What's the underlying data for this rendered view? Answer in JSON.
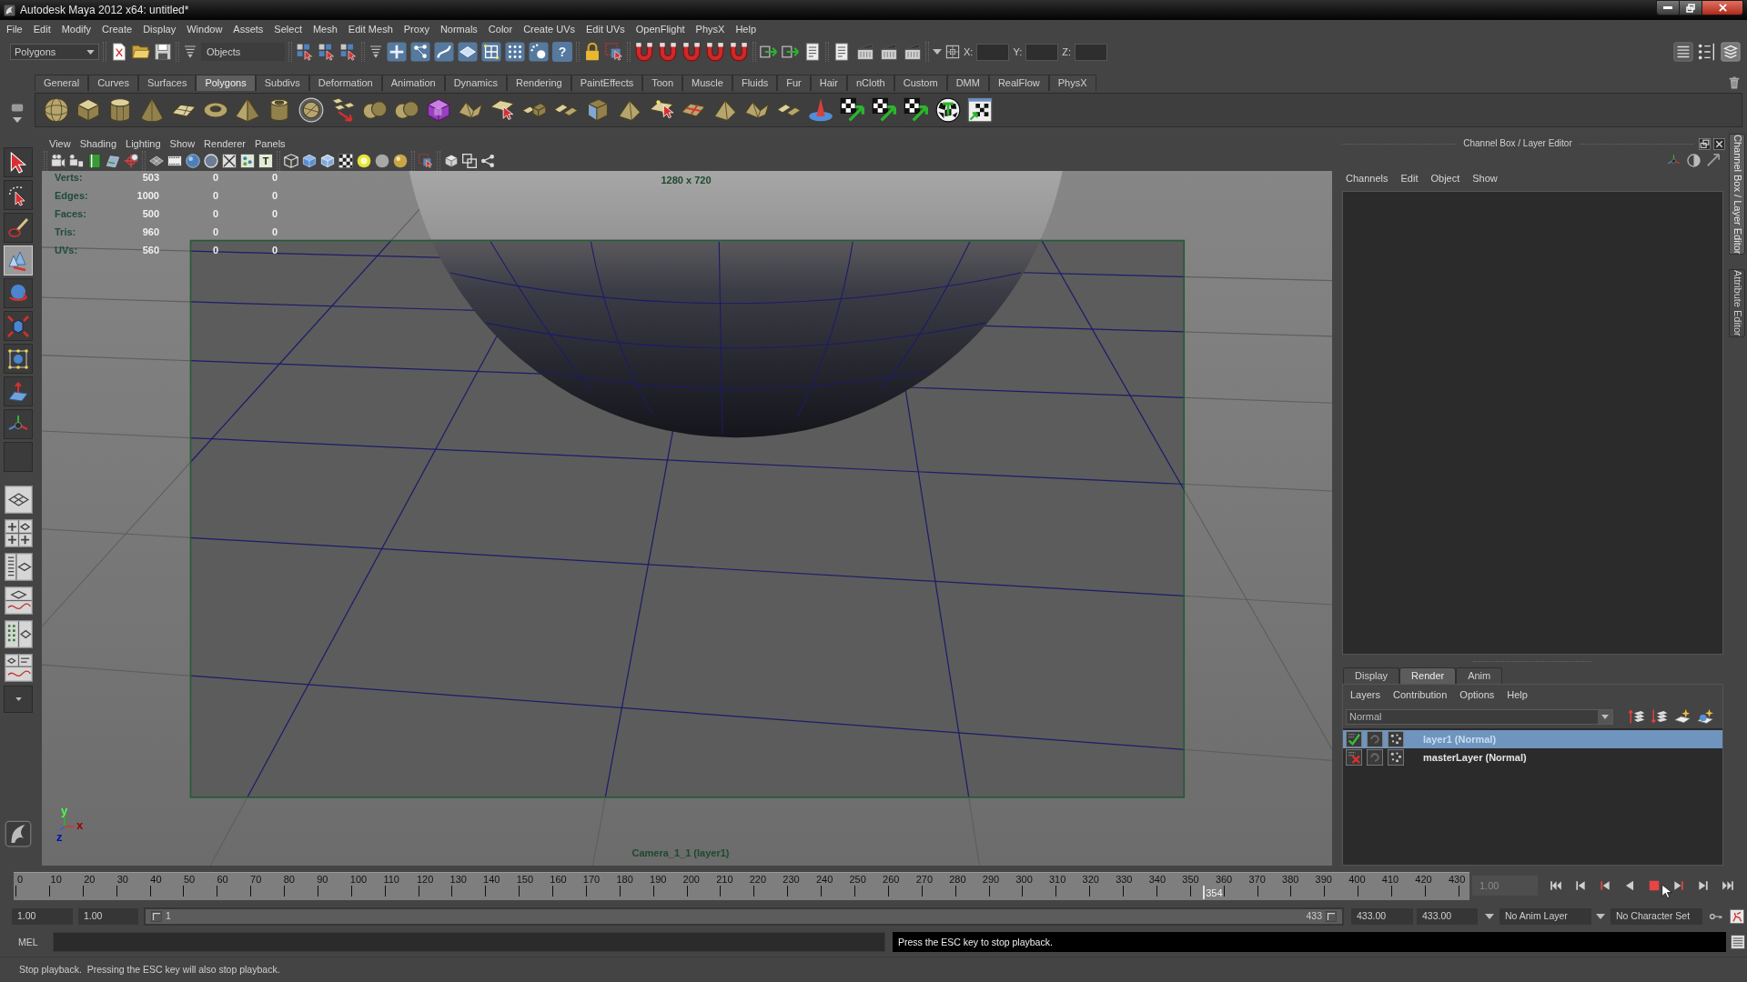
{
  "window": {
    "title": "Autodesk Maya 2012 x64: untitled*"
  },
  "menu_bar": [
    "File",
    "Edit",
    "Modify",
    "Create",
    "Display",
    "Window",
    "Assets",
    "Select",
    "Mesh",
    "Edit Mesh",
    "Proxy",
    "Normals",
    "Color",
    "Create UVs",
    "Edit UVs",
    "OpenFlight",
    "PhysX",
    "Help"
  ],
  "status_line": {
    "menu_set": "Polygons",
    "selection_mode": "Objects",
    "help_button": "?",
    "coordinate_fields": [
      {
        "label": "X:"
      },
      {
        "label": "Y:"
      },
      {
        "label": "Z:"
      }
    ]
  },
  "shelf": {
    "tabs": [
      {
        "label": "General",
        "selected": false
      },
      {
        "label": "Curves",
        "selected": false
      },
      {
        "label": "Surfaces",
        "selected": false
      },
      {
        "label": "Polygons",
        "selected": true
      },
      {
        "label": "Subdivs",
        "selected": false
      },
      {
        "label": "Deformation",
        "selected": false
      },
      {
        "label": "Animation",
        "selected": false
      },
      {
        "label": "Dynamics",
        "selected": false
      },
      {
        "label": "Rendering",
        "selected": false
      },
      {
        "label": "PaintEffects",
        "selected": false
      },
      {
        "label": "Toon",
        "selected": false
      },
      {
        "label": "Muscle",
        "selected": false
      },
      {
        "label": "Fluids",
        "selected": false
      },
      {
        "label": "Fur",
        "selected": false
      },
      {
        "label": "Hair",
        "selected": false
      },
      {
        "label": "nCloth",
        "selected": false
      },
      {
        "label": "Custom",
        "selected": false
      },
      {
        "label": "DMM",
        "selected": false
      },
      {
        "label": "RealFlow",
        "selected": false
      },
      {
        "label": "PhysX",
        "selected": false
      }
    ]
  },
  "toolbox": {
    "tools": [
      {
        "selected": false
      },
      {
        "selected": false
      },
      {
        "selected": false
      },
      {
        "selected": true
      },
      {
        "selected": false
      },
      {
        "selected": false
      },
      {
        "selected": false
      },
      {
        "selected": false
      },
      {
        "selected": false
      }
    ]
  },
  "viewport": {
    "menus": [
      "View",
      "Shading",
      "Lighting",
      "Show",
      "Renderer",
      "Panels"
    ],
    "text_button": "T",
    "hud": [
      {
        "label": "Verts:",
        "values": [
          "503",
          "0",
          "0"
        ]
      },
      {
        "label": "Edges:",
        "values": [
          "1000",
          "0",
          "0"
        ]
      },
      {
        "label": "Faces:",
        "values": [
          "500",
          "0",
          "0"
        ]
      },
      {
        "label": "Tris:",
        "values": [
          "960",
          "0",
          "0"
        ]
      },
      {
        "label": "UVs:",
        "values": [
          "560",
          "0",
          "0"
        ]
      }
    ],
    "resolution": "1280 x 720",
    "camera": "Camera_1_1 (layer1)",
    "axes": [
      "y",
      "x",
      "z"
    ]
  },
  "channel_box": {
    "title": "Channel Box / Layer Editor",
    "menus": [
      "Channels",
      "Edit",
      "Object",
      "Show"
    ]
  },
  "layer_editor": {
    "tabs": [
      {
        "label": "Display",
        "selected": false
      },
      {
        "label": "Render",
        "selected": true
      },
      {
        "label": "Anim",
        "selected": false
      }
    ],
    "menus": [
      "Layers",
      "Contribution",
      "Options",
      "Help"
    ],
    "blend_mode": "Normal",
    "layers": [
      {
        "name": "layer1 (Normal)",
        "selected": true,
        "renderable": true
      },
      {
        "name": "masterLayer (Normal)",
        "selected": false,
        "renderable": false
      }
    ]
  },
  "side_tabs": [
    {
      "label": "Channel Box / Layer Editor",
      "selected": true
    },
    {
      "label": "Attribute Editor",
      "selected": false
    }
  ],
  "time_slider": {
    "ticks": [
      "0",
      "10",
      "20",
      "30",
      "40",
      "50",
      "60",
      "70",
      "80",
      "90",
      "100",
      "110",
      "120",
      "130",
      "140",
      "150",
      "160",
      "170",
      "180",
      "190",
      "200",
      "210",
      "220",
      "230",
      "240",
      "250",
      "260",
      "270",
      "280",
      "290",
      "300",
      "310",
      "320",
      "330",
      "340",
      "350",
      "360",
      "370",
      "380",
      "390",
      "400",
      "410",
      "420",
      "430"
    ],
    "current_frame": "354",
    "level": 0.817,
    "current_time": "1.00",
    "playing": true
  },
  "range_slider": {
    "start_time": "1.00",
    "playback_start": "1.00",
    "range_start": "1",
    "range_end": "433",
    "level": 1,
    "playback_end": "433.00",
    "end_time": "433.00",
    "anim_layer": "No Anim Layer",
    "character_set": "No Character Set"
  },
  "command_line": {
    "language": "MEL",
    "result": "Press the ESC key to stop playback."
  },
  "help_line": "Stop playback.  Pressing the ESC key will also stop playback."
}
